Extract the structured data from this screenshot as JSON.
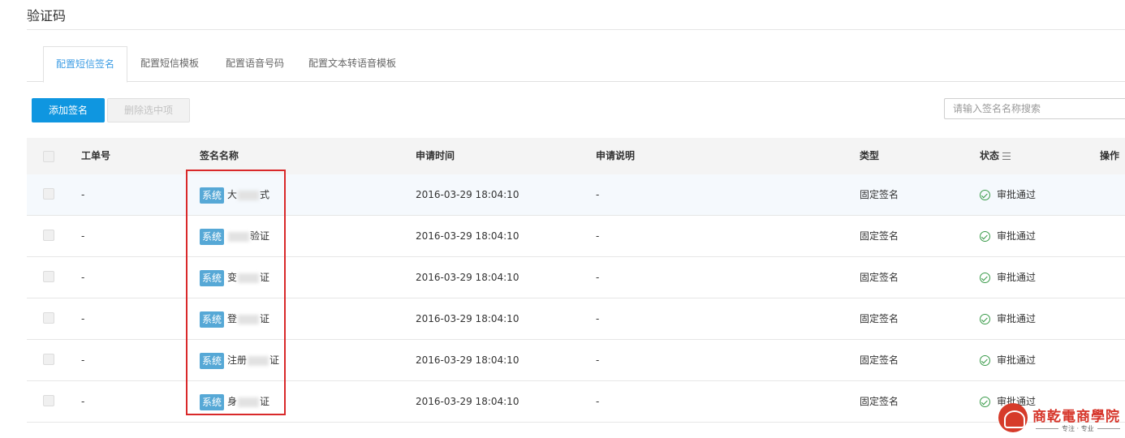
{
  "page": {
    "title": "验证码"
  },
  "tabs": [
    {
      "label": "配置短信签名",
      "active": true
    },
    {
      "label": "配置短信模板",
      "active": false
    },
    {
      "label": "配置语音号码",
      "active": false
    },
    {
      "label": "配置文本转语音模板",
      "active": false
    }
  ],
  "toolbar": {
    "add_label": "添加签名",
    "delete_label": "删除选中项",
    "search_placeholder": "请输入签名名称搜索"
  },
  "table": {
    "headers": {
      "ticket": "工单号",
      "name": "签名名称",
      "time": "申请时间",
      "desc": "申请说明",
      "type": "类型",
      "status": "状态",
      "action": "操作"
    },
    "rows": [
      {
        "ticket": "-",
        "tag": "系统",
        "name_start": "大",
        "name_end": "式",
        "time": "2016-03-29 18:04:10",
        "desc": "-",
        "type": "固定签名",
        "status": "审批通过"
      },
      {
        "ticket": "-",
        "tag": "系统",
        "name_start": "",
        "name_end": "验证",
        "time": "2016-03-29 18:04:10",
        "desc": "-",
        "type": "固定签名",
        "status": "审批通过"
      },
      {
        "ticket": "-",
        "tag": "系统",
        "name_start": "变",
        "name_end": "证",
        "time": "2016-03-29 18:04:10",
        "desc": "-",
        "type": "固定签名",
        "status": "审批通过"
      },
      {
        "ticket": "-",
        "tag": "系统",
        "name_start": "登",
        "name_end": "证",
        "time": "2016-03-29 18:04:10",
        "desc": "-",
        "type": "固定签名",
        "status": "审批通过"
      },
      {
        "ticket": "-",
        "tag": "系统",
        "name_start": "注册",
        "name_end": "证",
        "time": "2016-03-29 18:04:10",
        "desc": "-",
        "type": "固定签名",
        "status": "审批通过"
      },
      {
        "ticket": "-",
        "tag": "系统",
        "name_start": "身",
        "name_end": "证",
        "time": "2016-03-29 18:04:10",
        "desc": "-",
        "type": "固定签名",
        "status": "审批通过"
      }
    ]
  },
  "watermark": {
    "title": "商乾電商學院",
    "subtitle": "专注 · 专业"
  },
  "colors": {
    "primary": "#0f96e0",
    "tab_active": "#3d9de4",
    "tag": "#56a8d6",
    "success": "#3a9b4a",
    "highlight": "#d9292a"
  }
}
